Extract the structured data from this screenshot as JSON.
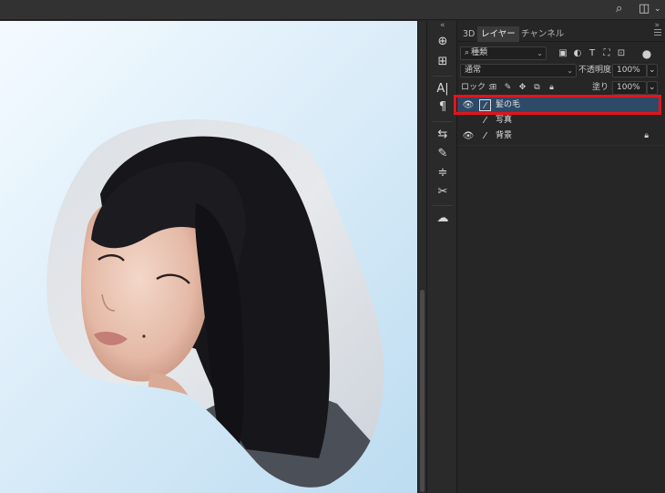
{
  "topbar": {
    "search_icon": "search-icon",
    "workspace_icon": "workspace-icon"
  },
  "panel": {
    "tabs": [
      {
        "label": "3D",
        "active": false
      },
      {
        "label": "レイヤー",
        "active": true
      },
      {
        "label": "チャンネル",
        "active": false
      }
    ],
    "filter": {
      "value": "種類"
    },
    "blend_mode": {
      "value": "通常"
    },
    "opacity": {
      "label": "不透明度 :",
      "value": "100%"
    },
    "lock": {
      "label": "ロック :"
    },
    "fill": {
      "label": "塗り :",
      "value": "100%"
    },
    "layers": [
      {
        "name": "髪の毛",
        "selected": true,
        "visible": true,
        "locked": false
      },
      {
        "name": "写真",
        "selected": false,
        "visible": false,
        "locked": false
      },
      {
        "name": "背景",
        "selected": false,
        "visible": true,
        "locked": true
      }
    ]
  },
  "highlight_color": "#e3141c",
  "selection_color": "#2f4a66"
}
